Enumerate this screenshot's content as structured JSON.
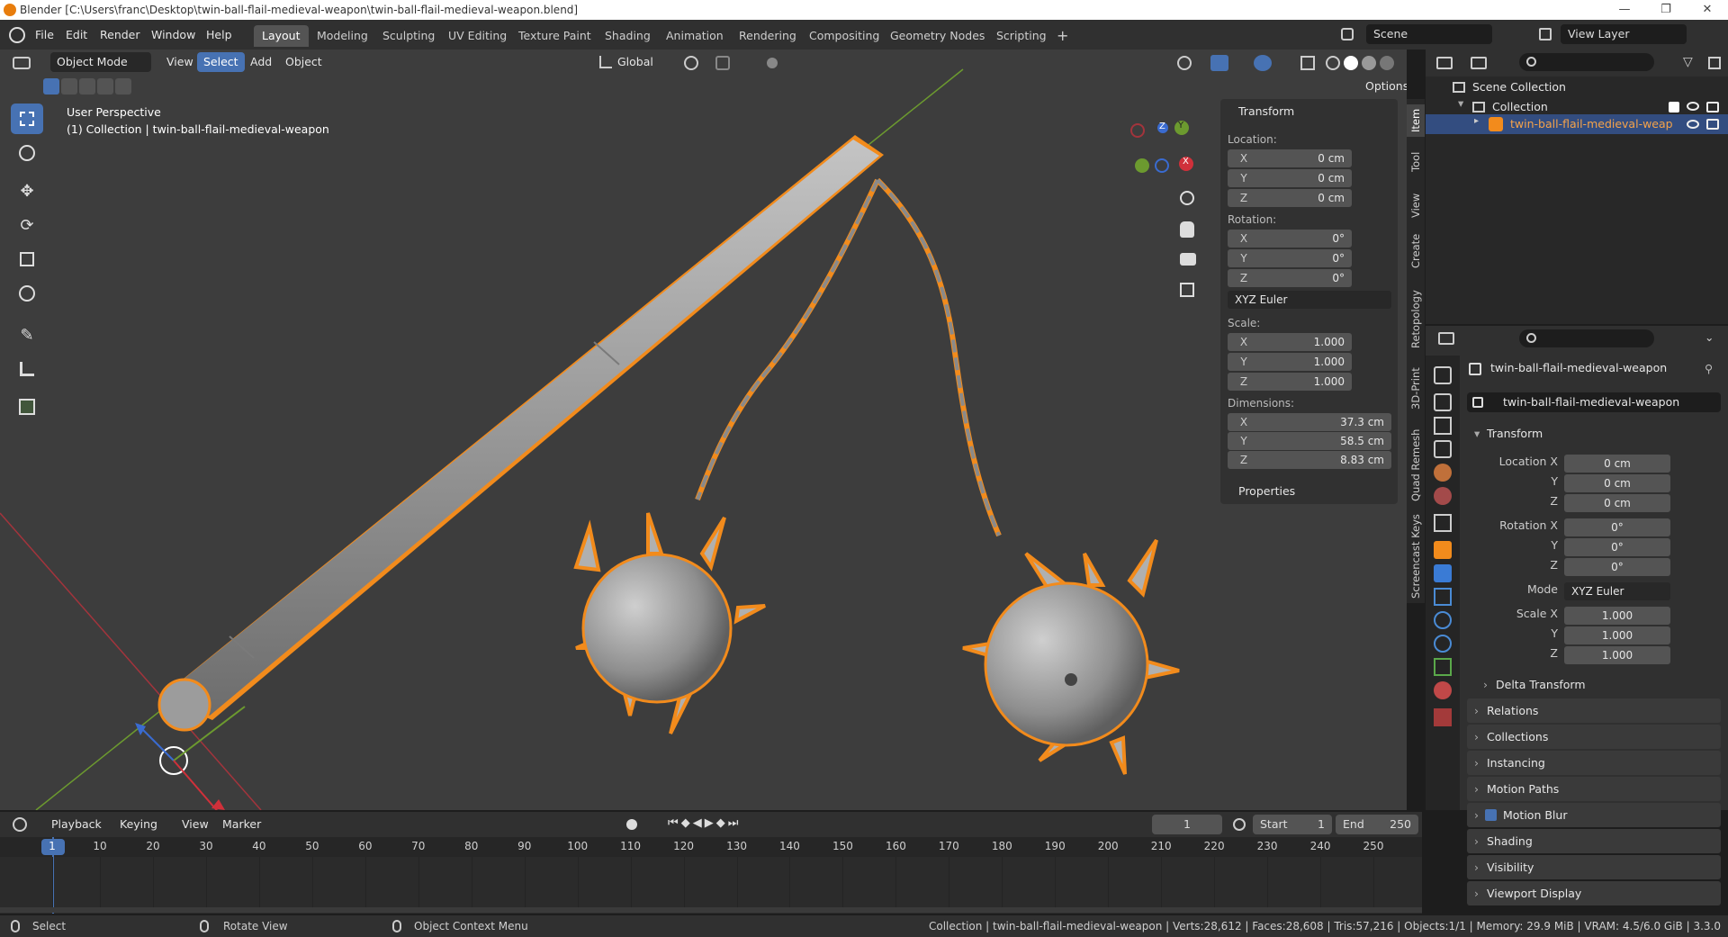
{
  "window": {
    "title": "Blender [C:\\Users\\franc\\Desktop\\twin-ball-flail-medieval-weapon\\twin-ball-flail-medieval-weapon.blend]",
    "controls": [
      "—",
      "❐",
      "✕"
    ]
  },
  "menubar": {
    "items": [
      "File",
      "Edit",
      "Render",
      "Window",
      "Help"
    ],
    "workspaces": [
      "Layout",
      "Modeling",
      "Sculpting",
      "UV Editing",
      "Texture Paint",
      "Shading",
      "Animation",
      "Rendering",
      "Compositing",
      "Geometry Nodes",
      "Scripting"
    ],
    "active_workspace": "Layout",
    "add_tab": "+",
    "scene": "Scene",
    "view_layer": "View Layer"
  },
  "viewport_header": {
    "mode": "Object Mode",
    "menus": [
      "View",
      "Select",
      "Add",
      "Object"
    ],
    "selected_menu": "Select",
    "orientation": "Global",
    "options": "Options"
  },
  "viewport": {
    "perspective": "User Perspective",
    "collection_info": "(1) Collection | twin-ball-flail-medieval-weapon",
    "gizmo_axes": [
      "X",
      "Y",
      "Z"
    ],
    "colors": {
      "accent": "#4772b3",
      "selection": "#f28b1c",
      "grid_red": "#a3343c",
      "grid_green": "#6c9a2f"
    }
  },
  "npanel": {
    "header": "Transform",
    "location_label": "Location:",
    "location": [
      {
        "axis": "X",
        "value": "0 cm"
      },
      {
        "axis": "Y",
        "value": "0 cm"
      },
      {
        "axis": "Z",
        "value": "0 cm"
      }
    ],
    "rotation_label": "Rotation:",
    "rotation": [
      {
        "axis": "X",
        "value": "0°"
      },
      {
        "axis": "Y",
        "value": "0°"
      },
      {
        "axis": "Z",
        "value": "0°"
      }
    ],
    "rotation_mode": "XYZ Euler",
    "scale_label": "Scale:",
    "scale": [
      {
        "axis": "X",
        "value": "1.000"
      },
      {
        "axis": "Y",
        "value": "1.000"
      },
      {
        "axis": "Z",
        "value": "1.000"
      }
    ],
    "dimensions_label": "Dimensions:",
    "dimensions": [
      {
        "axis": "X",
        "value": "37.3 cm"
      },
      {
        "axis": "Y",
        "value": "58.5 cm"
      },
      {
        "axis": "Z",
        "value": "8.83 cm"
      }
    ],
    "properties": "Properties",
    "tabs": [
      "Item",
      "Tool",
      "View",
      "Create",
      "Retopology",
      "3D-Print",
      "Quad Remesh",
      "Screencast Keys"
    ]
  },
  "outliner": {
    "scene_collection": "Scene Collection",
    "collection": "Collection",
    "object": "twin-ball-flail-medieval-weap"
  },
  "properties": {
    "object_name": "twin-ball-flail-medieval-weapon",
    "object_field": "twin-ball-flail-medieval-weapon",
    "transform": "Transform",
    "rows": [
      {
        "label": "Location X",
        "value": "0 cm"
      },
      {
        "label": "Y",
        "value": "0 cm"
      },
      {
        "label": "Z",
        "value": "0 cm"
      },
      {
        "label": "Rotation X",
        "value": "0°"
      },
      {
        "label": "Y",
        "value": "0°"
      },
      {
        "label": "Z",
        "value": "0°"
      },
      {
        "label": "Mode",
        "value": "XYZ Euler"
      },
      {
        "label": "Scale X",
        "value": "1.000"
      },
      {
        "label": "Y",
        "value": "1.000"
      },
      {
        "label": "Z",
        "value": "1.000"
      }
    ],
    "delta_transform": "Delta Transform",
    "sections": [
      "Relations",
      "Collections",
      "Instancing",
      "Motion Paths",
      "Motion Blur",
      "Shading",
      "Visibility",
      "Viewport Display"
    ]
  },
  "timeline": {
    "menus": [
      "Playback",
      "Keying",
      "View",
      "Marker"
    ],
    "current_frame": "1",
    "start_label": "Start",
    "start": "1",
    "end_label": "End",
    "end": "250",
    "ticks": [
      "1",
      "10",
      "20",
      "30",
      "40",
      "50",
      "60",
      "70",
      "80",
      "90",
      "100",
      "110",
      "120",
      "130",
      "140",
      "150",
      "160",
      "170",
      "180",
      "190",
      "200",
      "210",
      "220",
      "230",
      "240",
      "250"
    ]
  },
  "statusbar": {
    "select": "Select",
    "rotate": "Rotate View",
    "context": "Object Context Menu",
    "info": "Collection | twin-ball-flail-medieval-weapon | Verts:28,612 | Faces:28,608 | Tris:57,216 | Objects:1/1 | Memory: 29.9 MiB | VRAM: 4.5/6.0 GiB | 3.3.0"
  }
}
